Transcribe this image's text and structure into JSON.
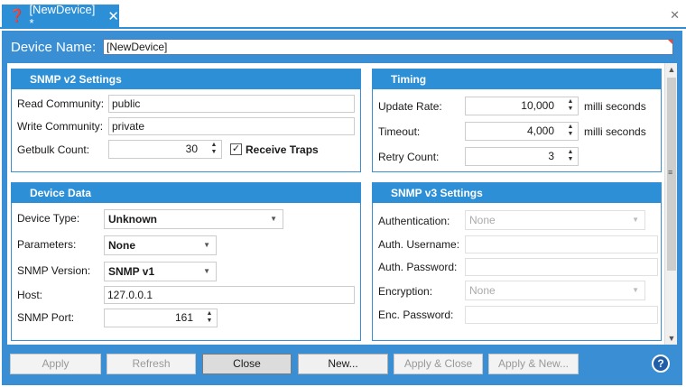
{
  "tab": {
    "title": "[NewDevice] *",
    "close_glyph": "✕",
    "icon": "question-icon"
  },
  "window": {
    "close_glyph": "✕"
  },
  "device_name": {
    "label": "Device Name:",
    "value": "[NewDevice]"
  },
  "snmp_v2": {
    "title": "SNMP v2 Settings",
    "read_community_label": "Read Community:",
    "read_community_value": "public",
    "write_community_label": "Write Community:",
    "write_community_value": "private",
    "getbulk_label": "Getbulk Count:",
    "getbulk_value": "30",
    "receive_traps_label": "Receive Traps",
    "receive_traps_checked": true
  },
  "timing": {
    "title": "Timing",
    "update_rate_label": "Update Rate:",
    "update_rate_value": "10,000",
    "update_rate_unit": "milli seconds",
    "timeout_label": "Timeout:",
    "timeout_value": "4,000",
    "timeout_unit": "milli seconds",
    "retry_label": "Retry Count:",
    "retry_value": "3"
  },
  "device_data": {
    "title": "Device Data",
    "device_type_label": "Device Type:",
    "device_type_value": "Unknown",
    "parameters_label": "Parameters:",
    "parameters_value": "None",
    "snmp_version_label": "SNMP Version:",
    "snmp_version_value": "SNMP v1",
    "host_label": "Host:",
    "host_value": "127.0.0.1",
    "port_label": "SNMP Port:",
    "port_value": "161"
  },
  "snmp_v3": {
    "title": "SNMP v3 Settings",
    "auth_label": "Authentication:",
    "auth_value": "None",
    "auth_user_label": "Auth. Username:",
    "auth_user_value": "",
    "auth_pass_label": "Auth. Password:",
    "auth_pass_value": "",
    "encryption_label": "Encryption:",
    "encryption_value": "None",
    "enc_pass_label": "Enc. Password:",
    "enc_pass_value": ""
  },
  "buttons": {
    "apply": "Apply",
    "refresh": "Refresh",
    "close": "Close",
    "new": "New...",
    "apply_close": "Apply & Close",
    "apply_new": "Apply & New...",
    "help": "?"
  },
  "colors": {
    "accent": "#2d8fd6",
    "frame": "#3a8fd4",
    "help": "#1f5ea8"
  }
}
